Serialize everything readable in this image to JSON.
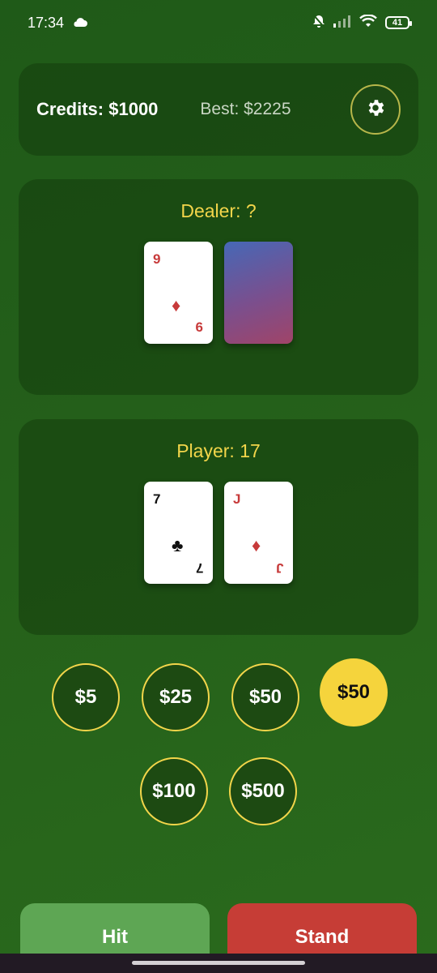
{
  "status": {
    "time": "17:34",
    "battery": "41"
  },
  "header": {
    "credits": "Credits: $1000",
    "best": "Best: $2225"
  },
  "dealer": {
    "title": "Dealer: ?",
    "cards": [
      {
        "rank": "9",
        "suit": "♦",
        "bottom": "6",
        "color": "#c73a3a"
      }
    ]
  },
  "player": {
    "title": "Player: 17",
    "cards": [
      {
        "rank": "7",
        "suit": "♣",
        "bottom": "7",
        "color": "#111111"
      },
      {
        "rank": "J",
        "suit": "♦",
        "bottom": "J",
        "color": "#c73a3a"
      }
    ]
  },
  "chips": {
    "row1": [
      "$5",
      "$25",
      "$50"
    ],
    "selected": "$50",
    "row2": [
      "$100",
      "$500"
    ]
  },
  "actions": {
    "hit": "Hit",
    "stand": "Stand"
  },
  "colors": {
    "accent": "#f2d54a",
    "hit": "#5ea654",
    "stand": "#c63d36"
  }
}
